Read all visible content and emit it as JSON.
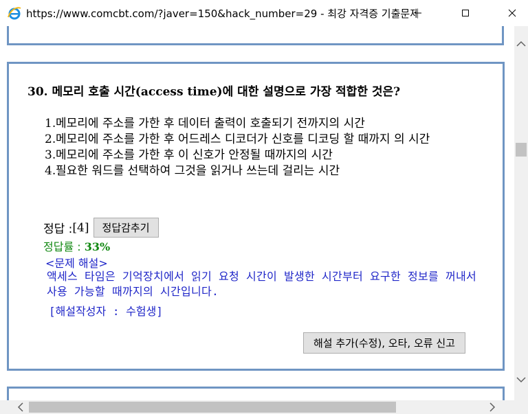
{
  "window": {
    "title": "https://www.comcbt.com/?javer=150&hack_number=29 - 최강 자격증 기출문제 ...",
    "minimize_icon": "minimize-icon",
    "maximize_icon": "maximize-icon",
    "close_icon": "close-icon",
    "brand_icon": "internet-explorer-icon"
  },
  "question": {
    "title": "30. 메모리 호출 시간(access time)에 대한 설명으로 가장 적합한 것은?",
    "choices": [
      {
        "num": "1.",
        "text": "메모리에 주소를 가한 후 데이터 출력이 호출되기 전까지의 시간"
      },
      {
        "num": "2.",
        "text": "메모리에 주소를 가한 후 어드레스 디코더가 신호를 디코딩 할 때까지 의 시간"
      },
      {
        "num": "3.",
        "text": "메모리에 주소를 가한 후 이 신호가 안정될 때까지의 시간"
      },
      {
        "num": "4.",
        "text": "필요한 워드를 선택하여 그것을 읽거나 쓰는데 걸리는 시간"
      }
    ]
  },
  "answer": {
    "label": "정답 : ",
    "value": "[4]",
    "hide_button": "정답감추기"
  },
  "rate": {
    "label": "정답률 : ",
    "value": "33%"
  },
  "explanation": {
    "heading": "<문제 해설>",
    "body": "액세스 타임은 기억장치에서 읽기 요청 시간이 발생한 시간부터 요구한 정보를 꺼내서 사용 가능할 때까지의 시간입니다.",
    "author": "[해설작성자 : 수험생]"
  },
  "report_button": "해설 추가(수정), 오타, 오류 신고",
  "colors": {
    "frame": "#6f95c3",
    "rate": "#118811",
    "explanation": "#1f26c8"
  }
}
